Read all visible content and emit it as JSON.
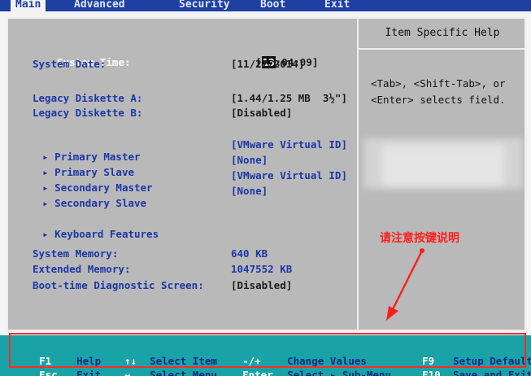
{
  "menu": {
    "tabs": [
      "Main",
      "Advanced",
      "Security",
      "Boot",
      "Exit"
    ],
    "active": "Main"
  },
  "help": {
    "title": "Item Specific Help",
    "text": "<Tab>, <Shift-Tab>, or\n<Enter> selects field."
  },
  "system_time": {
    "label": "System Time:",
    "hour": "13",
    "rest": ":04:09]",
    "open": "["
  },
  "system_date": {
    "label": "System Date:",
    "value": "[11/27/2014]"
  },
  "diskette_a": {
    "label": "Legacy Diskette A:",
    "value": "[1.44/1.25 MB  3½\"]"
  },
  "diskette_b": {
    "label": "Legacy Diskette B:",
    "value": "[Disabled]"
  },
  "drives": [
    {
      "label": "Primary Master",
      "value": "[VMware Virtual ID]"
    },
    {
      "label": "Primary Slave",
      "value": "[None]"
    },
    {
      "label": "Secondary Master",
      "value": "[VMware Virtual ID]"
    },
    {
      "label": "Secondary Slave",
      "value": "[None]"
    }
  ],
  "keyboard_features": {
    "label": "Keyboard Features"
  },
  "memory": [
    {
      "label": "System Memory:",
      "value": "640 KB"
    },
    {
      "label": "Extended Memory:",
      "value": "1047552 KB"
    }
  ],
  "diag": {
    "label": "Boot-time Diagnostic Screen:",
    "value": "[Disabled]"
  },
  "annotation": {
    "text": "请注意按键说明",
    "color": "#ff1f1f"
  },
  "keys": [
    {
      "key": "F1",
      "desc": "Help"
    },
    {
      "key": "Esc",
      "desc": "Exit"
    },
    {
      "key": "↑↓",
      "desc": "Select Item"
    },
    {
      "key": "↔",
      "desc": "Select Menu"
    },
    {
      "key": "-/+",
      "desc": "Change Values"
    },
    {
      "key": "Enter",
      "desc": "Select ▸ Sub-Menu"
    },
    {
      "key": "F9",
      "desc": "Setup Defaults"
    },
    {
      "key": "F10",
      "desc": "Save and Exit"
    }
  ],
  "colors": {
    "menubar": "#1f3fa2",
    "panel": "#b9b9b9",
    "keybar": "#19a3a6",
    "label": "#1c37a6"
  }
}
